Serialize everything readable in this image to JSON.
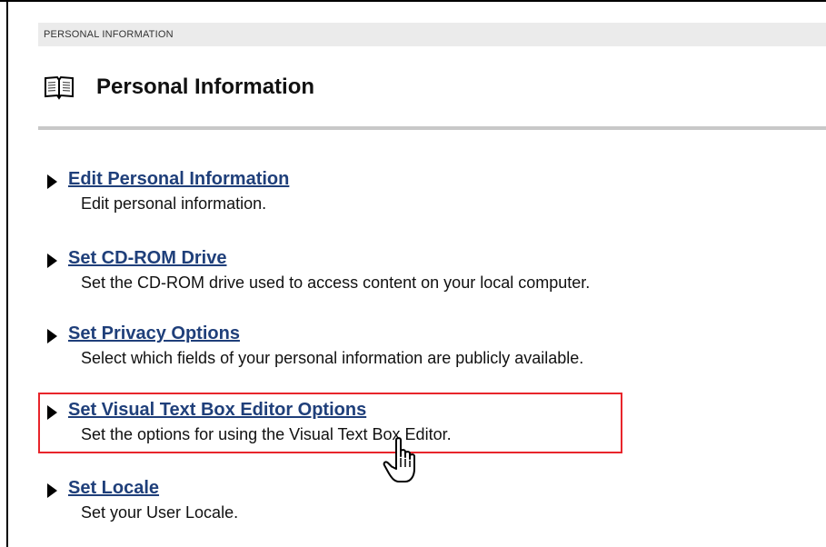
{
  "breadcrumb": "PERSONAL INFORMATION",
  "header": {
    "title": "Personal Information",
    "icon": "book-icon"
  },
  "menu": {
    "items": [
      {
        "label": "Edit Personal Information",
        "description": "Edit personal information."
      },
      {
        "label": "Set CD-ROM Drive",
        "description": "Set the CD-ROM drive used to access content on your local computer."
      },
      {
        "label": "Set Privacy Options",
        "description": "Select which fields of your personal information are publicly available."
      },
      {
        "label": "Set Visual Text Box Editor Options",
        "description": "Set the options for using the Visual Text Box Editor.",
        "highlighted": true
      },
      {
        "label": "Set Locale",
        "description": "Set your User Locale."
      }
    ]
  },
  "colors": {
    "link": "#1f3f7a",
    "highlight": "#e8252b",
    "breadcrumb_bg": "#ebebeb",
    "rule": "#c8c8c8"
  },
  "cursor": "hand-pointer-icon"
}
